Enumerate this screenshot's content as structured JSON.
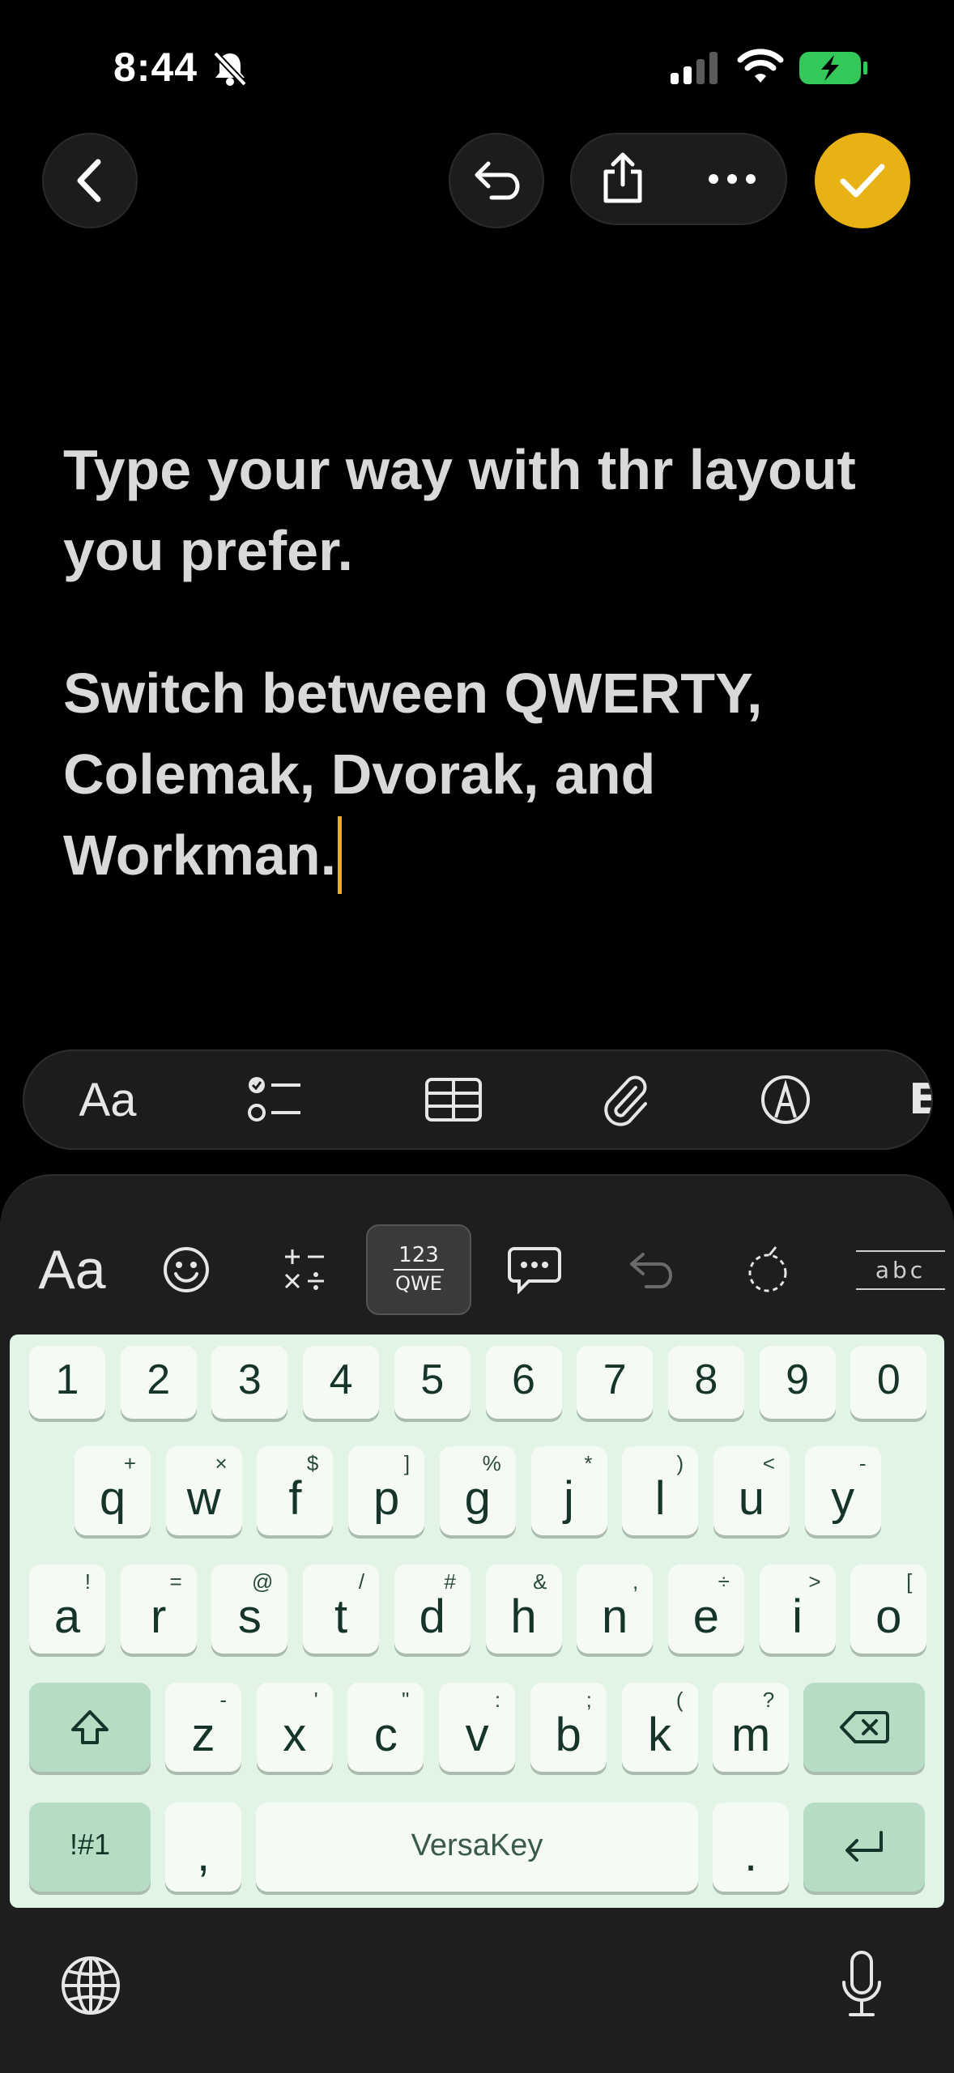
{
  "status": {
    "time": "8:44"
  },
  "note": {
    "paragraph1": "Type your way with thr layout you prefer.",
    "paragraph2": "Switch between QWERTY, Colemak, Dvorak, and Workman."
  },
  "format_toolbar": {
    "text_style_label": "Aa",
    "partial_label": "E"
  },
  "keyboard_toolbar": {
    "text_style_label": "Aa",
    "layout_toggle_top": "123",
    "layout_toggle_bottom": "QWE",
    "abc_label": "abc"
  },
  "keyboard": {
    "number_row": [
      "1",
      "2",
      "3",
      "4",
      "5",
      "6",
      "7",
      "8",
      "9",
      "0"
    ],
    "row1": [
      {
        "k": "q",
        "alt": "+"
      },
      {
        "k": "w",
        "alt": "×"
      },
      {
        "k": "f",
        "alt": "$"
      },
      {
        "k": "p",
        "alt": "]"
      },
      {
        "k": "g",
        "alt": "%"
      },
      {
        "k": "j",
        "alt": "*"
      },
      {
        "k": "l",
        "alt": ")"
      },
      {
        "k": "u",
        "alt": "<"
      },
      {
        "k": "y",
        "alt": "-"
      }
    ],
    "row2": [
      {
        "k": "a",
        "alt": "!"
      },
      {
        "k": "r",
        "alt": "="
      },
      {
        "k": "s",
        "alt": "@"
      },
      {
        "k": "t",
        "alt": "/"
      },
      {
        "k": "d",
        "alt": "#"
      },
      {
        "k": "h",
        "alt": "&"
      },
      {
        "k": "n",
        "alt": ","
      },
      {
        "k": "e",
        "alt": "÷"
      },
      {
        "k": "i",
        "alt": ">"
      },
      {
        "k": "o",
        "alt": "["
      }
    ],
    "row3": [
      {
        "k": "z",
        "alt": "-"
      },
      {
        "k": "x",
        "alt": "'"
      },
      {
        "k": "c",
        "alt": "\""
      },
      {
        "k": "v",
        "alt": ":"
      },
      {
        "k": "b",
        "alt": ";"
      },
      {
        "k": "k",
        "alt": "("
      },
      {
        "k": "m",
        "alt": "?"
      }
    ],
    "symbols_label": "!#1",
    "comma_label": ",",
    "space_label": "VersaKey",
    "period_label": "."
  },
  "colors": {
    "accent": "#e8b114",
    "keyboard_bg": "#e2f4e6",
    "key_bg": "#f5faf5",
    "modifier_key_bg": "#b6dcc3"
  }
}
